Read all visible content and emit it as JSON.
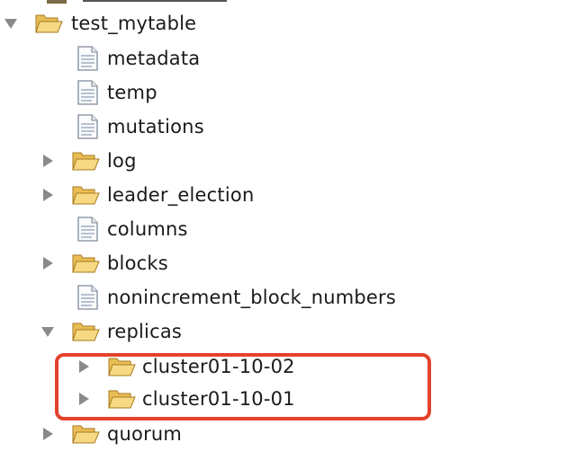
{
  "tree": {
    "items": [
      {
        "label": "test_mytable",
        "type": "folder",
        "expanded": true
      },
      {
        "label": "metadata",
        "type": "file"
      },
      {
        "label": "temp",
        "type": "file"
      },
      {
        "label": "mutations",
        "type": "file"
      },
      {
        "label": "log",
        "type": "folder",
        "expanded": false
      },
      {
        "label": "leader_election",
        "type": "folder",
        "expanded": false
      },
      {
        "label": "columns",
        "type": "file"
      },
      {
        "label": "blocks",
        "type": "folder",
        "expanded": false
      },
      {
        "label": "nonincrement_block_numbers",
        "type": "file"
      },
      {
        "label": "replicas",
        "type": "folder",
        "expanded": true
      },
      {
        "label": "cluster01-10-02",
        "type": "folder",
        "expanded": false
      },
      {
        "label": "cluster01-10-01",
        "type": "folder",
        "expanded": false
      },
      {
        "label": "quorum",
        "type": "folder",
        "expanded": false
      }
    ]
  },
  "colors": {
    "highlight": "#e3422c",
    "folder": "#f3cf74",
    "twisty": "#8a8a8a"
  },
  "icons": {
    "folder": "folder-open-icon",
    "file": "document-icon",
    "collapsed": "chevron-right-icon",
    "expanded": "chevron-down-icon"
  }
}
